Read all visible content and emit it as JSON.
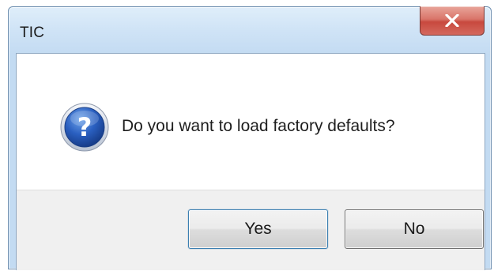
{
  "window": {
    "title": "TIC"
  },
  "dialog": {
    "message": "Do you want to load factory defaults?",
    "icon": "question-icon",
    "buttons": {
      "yes_label": "Yes",
      "no_label": "No"
    }
  },
  "colors": {
    "close_button": "#c8493e",
    "title_bar": "#cfe3f6",
    "button_bar": "#f0f0f0",
    "icon_blue": "#1f4ea8"
  }
}
